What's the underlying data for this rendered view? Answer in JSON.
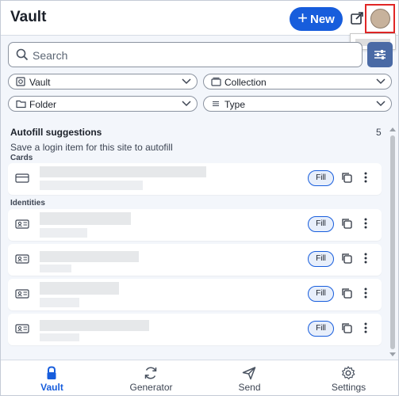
{
  "header": {
    "title": "Vault",
    "new_label": "New"
  },
  "search": {
    "placeholder": "Search"
  },
  "filters": [
    {
      "label": "Vault",
      "icon": "vault-icon"
    },
    {
      "label": "Collection",
      "icon": "collection-icon"
    },
    {
      "label": "Folder",
      "icon": "folder-icon"
    },
    {
      "label": "Type",
      "icon": "list-icon"
    }
  ],
  "autofill": {
    "title": "Autofill suggestions",
    "count": "5",
    "subtitle": "Save a login item for this site to autofill",
    "groups": [
      {
        "name": "Cards",
        "items": [
          {
            "type": "card",
            "fill_label": "Fill"
          }
        ]
      },
      {
        "name": "Identities",
        "items": [
          {
            "type": "identity",
            "fill_label": "Fill"
          },
          {
            "type": "identity",
            "fill_label": "Fill"
          },
          {
            "type": "identity",
            "fill_label": "Fill"
          },
          {
            "type": "identity",
            "fill_label": "Fill"
          }
        ]
      }
    ]
  },
  "nav": [
    {
      "label": "Vault",
      "icon": "lock-icon",
      "active": true
    },
    {
      "label": "Generator",
      "icon": "refresh-icon",
      "active": false
    },
    {
      "label": "Send",
      "icon": "send-icon",
      "active": false
    },
    {
      "label": "Settings",
      "icon": "gear-icon",
      "active": false
    }
  ],
  "colors": {
    "primary": "#175ddc",
    "filter_button": "#4a6aa5",
    "highlight": "#e12626"
  }
}
